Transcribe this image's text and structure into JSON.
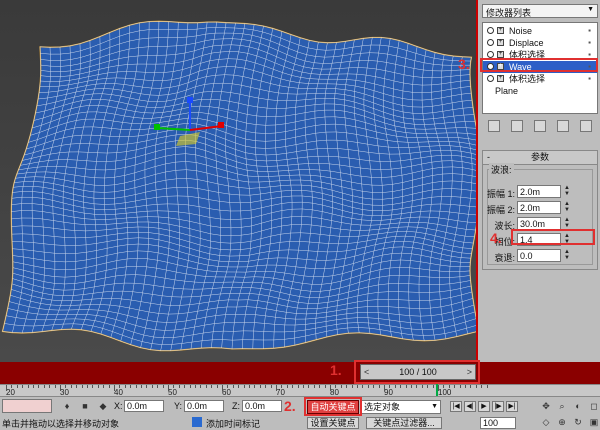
{
  "command_panel": {
    "modifier_list_label": "修改器列表",
    "stack_items": [
      {
        "label": "Noise",
        "selected": false
      },
      {
        "label": "Displace",
        "selected": false
      },
      {
        "label": "体积选择",
        "selected": false
      },
      {
        "label": "Wave",
        "selected": true
      },
      {
        "label": "体积选择",
        "selected": false
      }
    ],
    "base_object": "Plane",
    "rollout_title": "参数",
    "group_label": "波浪:",
    "params": [
      {
        "label": "振幅 1:",
        "value": "2.0m"
      },
      {
        "label": "振幅 2:",
        "value": "2.0m"
      },
      {
        "label": "波长:",
        "value": "30.0m"
      },
      {
        "label": "相位:",
        "value": "1.4"
      },
      {
        "label": "衰退:",
        "value": "0.0"
      }
    ]
  },
  "markers": {
    "m1": "1.",
    "m2": "2.",
    "m3": "3.",
    "m4": "4."
  },
  "time_slider": {
    "value": "100 / 100",
    "left_arrow": "<",
    "right_arrow": ">"
  },
  "track_labels": [
    "20",
    "30",
    "40",
    "50",
    "60",
    "70",
    "80",
    "90",
    "100"
  ],
  "status": {
    "x_label": "X:",
    "x_value": "0.0m",
    "y_label": "Y:",
    "y_value": "0.0m",
    "z_label": "Z:",
    "z_value": "0.0m",
    "prompt": "单击并拖动以选择并移动对象",
    "add_time_tag": "添加时间标记",
    "auto_key": "自动关键点",
    "selected_set": "选定对象",
    "set_key": "设置关键点",
    "key_filters": "关键点过滤器...",
    "frame": "100"
  },
  "colors": {
    "highlight": "#e03030",
    "timebar": "#8a0000",
    "mesh": "#2a5db0",
    "selection": "#2d5fc7"
  }
}
